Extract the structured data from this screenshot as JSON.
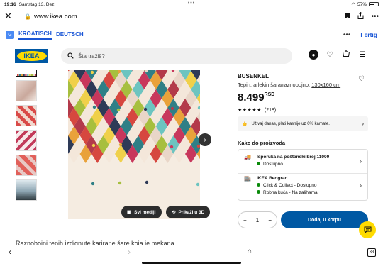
{
  "status": {
    "time": "19:16",
    "date": "Samstag 13. Dez.",
    "battery": "57%"
  },
  "browser": {
    "url": "www.ikea.com",
    "lock": "🔒"
  },
  "translate": {
    "lang_active": "KROATISCH",
    "lang_other": "DEUTSCH",
    "more": "•••",
    "done": "Fertig"
  },
  "header": {
    "logo": "IKEA",
    "search_placeholder": "Šta tražiš?"
  },
  "gallery": {
    "buttons": [
      {
        "label": "Svi mediji"
      },
      {
        "label": "Prikaži u 3D"
      }
    ]
  },
  "product": {
    "brand": "BUSENKEL",
    "description": "Tepih, arlekin šara/raznobojno,",
    "size": "130x160 cm",
    "price": "8.499",
    "currency": "RSD",
    "stars": "★★★★★",
    "rating_count": "(218)",
    "rating_value": 5
  },
  "promo": {
    "text": "Uživaj danas, plati kasnije uz 0% kamate."
  },
  "delivery": {
    "heading": "Kako do proizvoda",
    "ship": {
      "title": "Isporuka na poštanski broj 11000",
      "status": "Dostupno"
    },
    "store": {
      "title": "IKEA Beograd",
      "line1": "Click & Collect - Dostupno",
      "line2": "Robna kuća - Na zalihama"
    }
  },
  "cart": {
    "qty": "1",
    "minus": "−",
    "plus": "+",
    "add_label": "Dodaj u korpu"
  },
  "body_text": "Raznobojni tepih izdignute karirane šare koja je mekana",
  "bottom": {
    "tabs_count": "33"
  },
  "colors": {
    "ikea_blue": "#0058a3",
    "ikea_yellow": "#ffdb00",
    "translate_blue": "#1a56d6",
    "stock_green": "#0a8a0a"
  }
}
